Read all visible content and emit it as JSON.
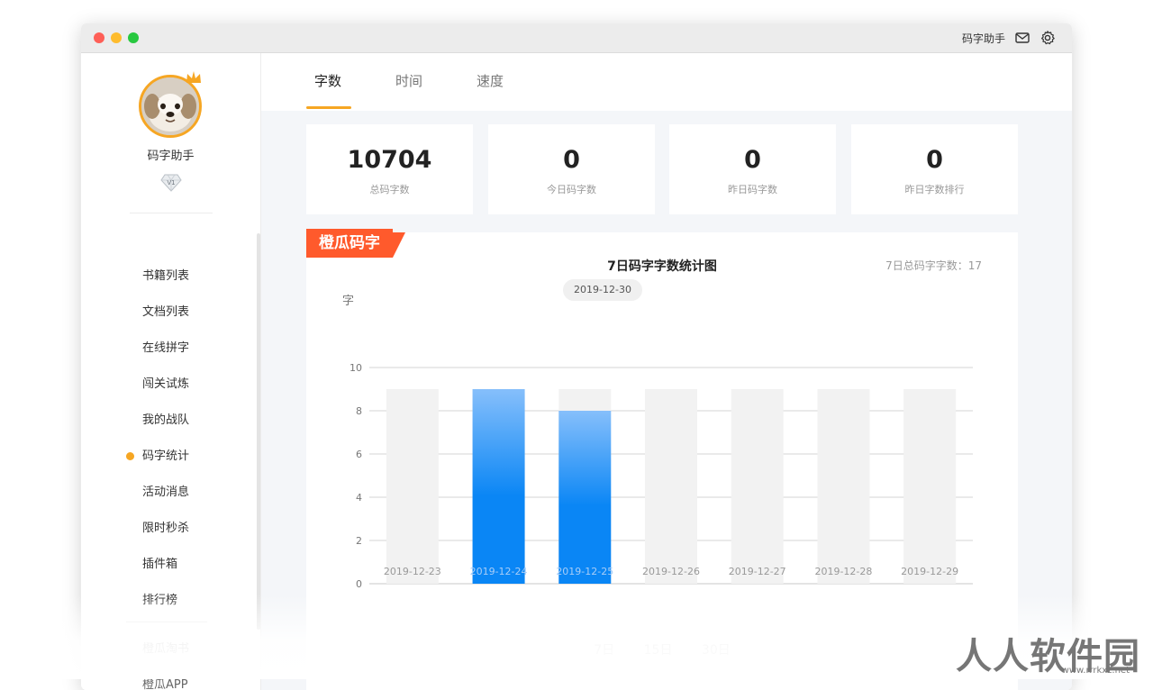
{
  "titlebar": {
    "app_title": "码字助手"
  },
  "sidebar": {
    "username": "码字助手",
    "nav_items": [
      {
        "label": "书籍列表",
        "active": false
      },
      {
        "label": "文档列表",
        "active": false
      },
      {
        "label": "在线拼字",
        "active": false
      },
      {
        "label": "闯关试炼",
        "active": false
      },
      {
        "label": "我的战队",
        "active": false
      },
      {
        "label": "码字统计",
        "active": true
      },
      {
        "label": "活动消息",
        "active": false
      },
      {
        "label": "限时秒杀",
        "active": false
      },
      {
        "label": "插件箱",
        "active": false
      },
      {
        "label": "排行榜",
        "active": false
      }
    ],
    "extra_items": [
      {
        "label": "橙瓜淘书"
      },
      {
        "label": "橙瓜APP"
      }
    ]
  },
  "tabs": [
    {
      "label": "字数",
      "active": true
    },
    {
      "label": "时间",
      "active": false
    },
    {
      "label": "速度",
      "active": false
    }
  ],
  "stats": [
    {
      "value": "10704",
      "label": "总码字数"
    },
    {
      "value": "0",
      "label": "今日码字数"
    },
    {
      "value": "0",
      "label": "昨日码字数"
    },
    {
      "value": "0",
      "label": "昨日字数排行"
    }
  ],
  "chart_panel": {
    "badge": "橙瓜码字",
    "title": "7日码字字数统计图",
    "total_label": "7日总码字字数：",
    "total_value": "17",
    "selected_date": "2019-12-30",
    "ranges": [
      "7日",
      "15日",
      "30日"
    ]
  },
  "chart_data": {
    "type": "bar",
    "ylabel": "字",
    "categories": [
      "2019-12-23",
      "2019-12-24",
      "2019-12-25",
      "2019-12-26",
      "2019-12-27",
      "2019-12-28",
      "2019-12-29"
    ],
    "values": [
      0,
      9,
      8,
      0,
      0,
      0,
      0
    ],
    "ylim": [
      0,
      10
    ],
    "yticks": [
      0,
      2,
      4,
      6,
      8,
      10
    ],
    "bar_color": "#0a86f5",
    "bar_color_top": "#86bffb",
    "background_bar_color": "#f2f2f2",
    "grid": true
  },
  "watermark": {
    "text": "人人软件园",
    "sub": "www.rrrkxz.net"
  },
  "colors": {
    "accent": "#f6a623",
    "ribbon": "#ff5a2c"
  }
}
